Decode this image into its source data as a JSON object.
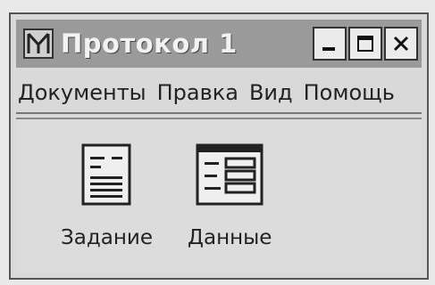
{
  "window": {
    "title": "Протокол 1",
    "icon": "network-app-icon",
    "controls": [
      "minimize-icon",
      "maximize-icon",
      "close-icon"
    ]
  },
  "menubar": {
    "items": [
      "Документы",
      "Правка",
      "Вид",
      "Помощь"
    ]
  },
  "content": {
    "items": [
      {
        "label": "Задание",
        "icon": "document-icon"
      },
      {
        "label": "Данные",
        "icon": "table-icon"
      }
    ]
  }
}
